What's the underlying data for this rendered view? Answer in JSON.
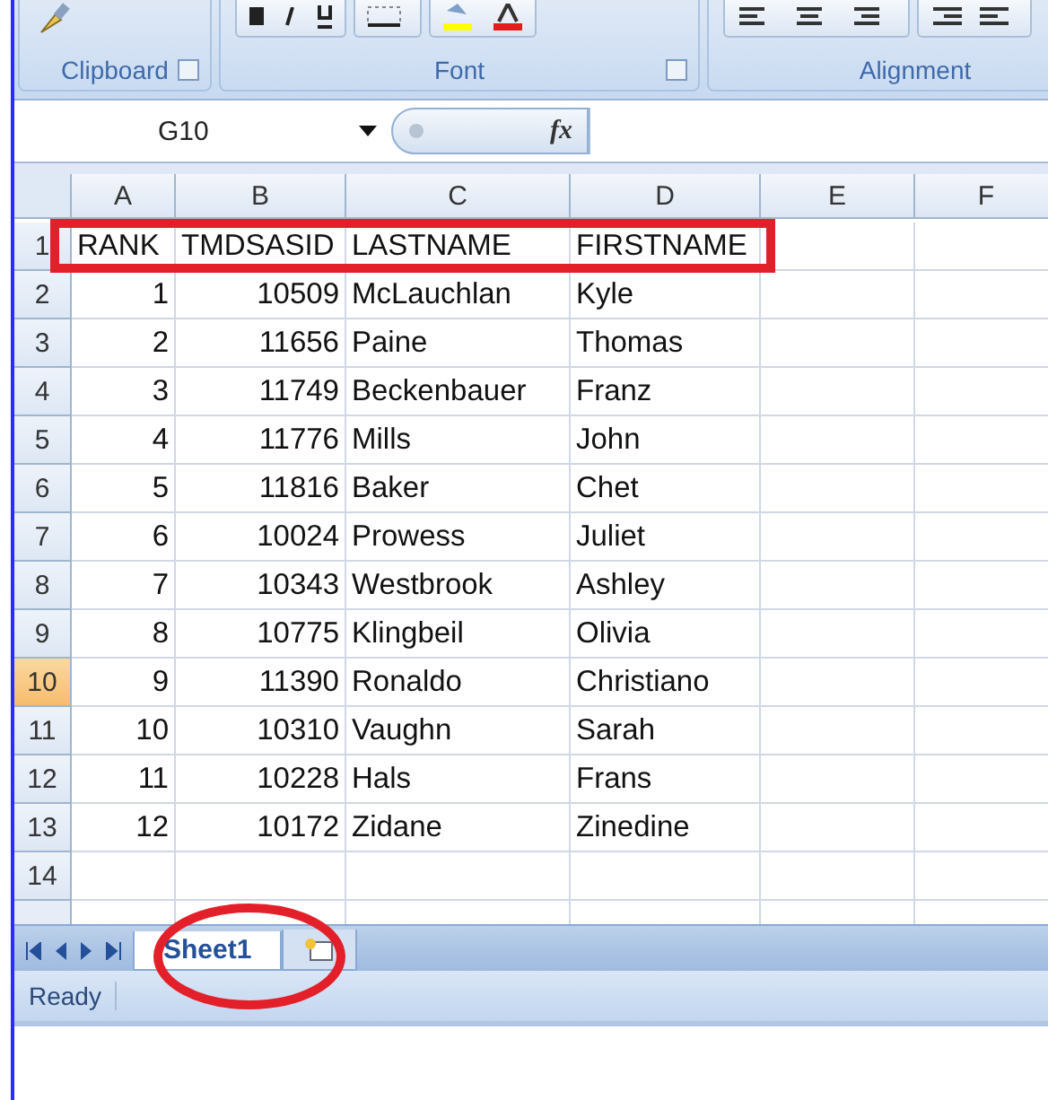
{
  "ribbon": {
    "groups": [
      {
        "label": "Clipboard",
        "launcher": true
      },
      {
        "label": "Font",
        "launcher": true
      },
      {
        "label": "Alignment"
      }
    ]
  },
  "formula_bar": {
    "name_box": "G10",
    "function_symbol": "fx"
  },
  "sheet": {
    "columns": [
      "A",
      "B",
      "C",
      "D",
      "E",
      "F"
    ],
    "rows": [
      {
        "number": "1",
        "selected": false,
        "cells": [
          "RANK",
          "TMDSASID",
          "LASTNAME",
          "FIRSTNAME"
        ]
      },
      {
        "number": "2",
        "selected": false,
        "cells": [
          "1",
          "10509",
          "McLauchlan",
          "Kyle"
        ]
      },
      {
        "number": "3",
        "selected": false,
        "cells": [
          "2",
          "11656",
          "Paine",
          "Thomas"
        ]
      },
      {
        "number": "4",
        "selected": false,
        "cells": [
          "3",
          "11749",
          "Beckenbauer",
          "Franz"
        ]
      },
      {
        "number": "5",
        "selected": false,
        "cells": [
          "4",
          "11776",
          "Mills",
          "John"
        ]
      },
      {
        "number": "6",
        "selected": false,
        "cells": [
          "5",
          "11816",
          "Baker",
          "Chet"
        ]
      },
      {
        "number": "7",
        "selected": false,
        "cells": [
          "6",
          "10024",
          "Prowess",
          "Juliet"
        ]
      },
      {
        "number": "8",
        "selected": false,
        "cells": [
          "7",
          "10343",
          "Westbrook",
          "Ashley"
        ]
      },
      {
        "number": "9",
        "selected": false,
        "cells": [
          "8",
          "10775",
          "Klingbeil",
          "Olivia"
        ]
      },
      {
        "number": "10",
        "selected": true,
        "cells": [
          "9",
          "11390",
          "Ronaldo",
          "Christiano"
        ]
      },
      {
        "number": "11",
        "selected": false,
        "cells": [
          "10",
          "10310",
          "Vaughn",
          "Sarah"
        ]
      },
      {
        "number": "12",
        "selected": false,
        "cells": [
          "11",
          "10228",
          "Hals",
          "Frans"
        ]
      },
      {
        "number": "13",
        "selected": false,
        "cells": [
          "12",
          "10172",
          "Zidane",
          "Zinedine"
        ]
      },
      {
        "number": "14",
        "selected": false
      }
    ]
  },
  "sheet_tabs": [
    {
      "label": "Sheet1",
      "selected": true
    }
  ],
  "status_bar": {
    "text": "Ready"
  }
}
